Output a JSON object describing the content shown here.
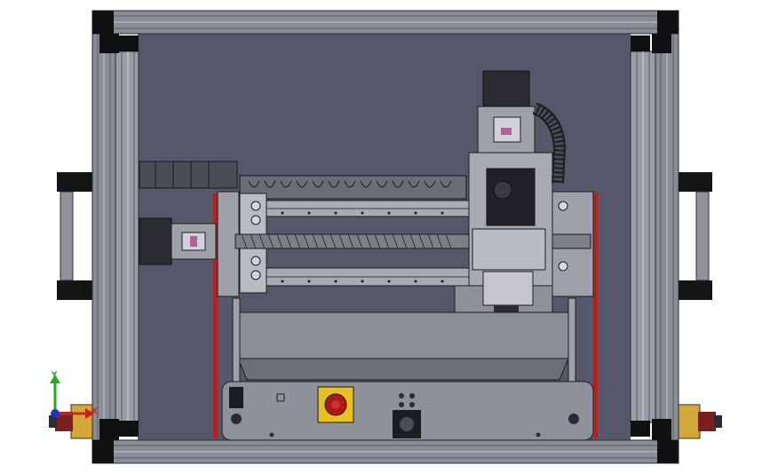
{
  "viewport": {
    "background_color": "#ffffff",
    "enclosure_back_panel_color": "#555868",
    "frame_color": "#8a8d96",
    "frame_dark_color": "#2a2c31",
    "corner_bracket_color": "#101113",
    "rail_color": "#b22222",
    "emergency_stop_base_color": "#e8c020",
    "emergency_stop_button_color": "#b01818",
    "axis_colors": {
      "x": "#cc2222",
      "y": "#22aa22",
      "z": "#2233cc"
    }
  },
  "triad": {
    "x_label": "X",
    "y_label": "Y"
  },
  "model": {
    "icons": [
      "stepper-motor-icon",
      "emergency-stop-icon",
      "cable-chain-icon",
      "lead-screw-icon",
      "handle-icon",
      "power-connector-icon"
    ]
  }
}
